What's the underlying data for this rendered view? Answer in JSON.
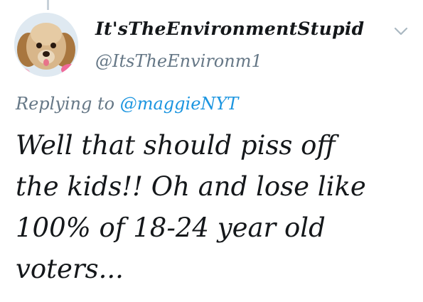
{
  "author": {
    "display_name": "It'sTheEnvironmentStupid",
    "handle": "@ItsTheEnvironm1",
    "avatar": "puppy-avatar"
  },
  "menu": {
    "icon": "chevron-down-icon"
  },
  "reply": {
    "prefix": "Replying to",
    "mention": "@maggieNYT"
  },
  "tweet": {
    "lines": [
      "Well that should piss off",
      "the kids!! Oh and lose like",
      "100% of 18-24 year old",
      "voters..."
    ]
  },
  "colors": {
    "text": "#14171a",
    "muted": "#657786",
    "link": "#1b95e0"
  }
}
